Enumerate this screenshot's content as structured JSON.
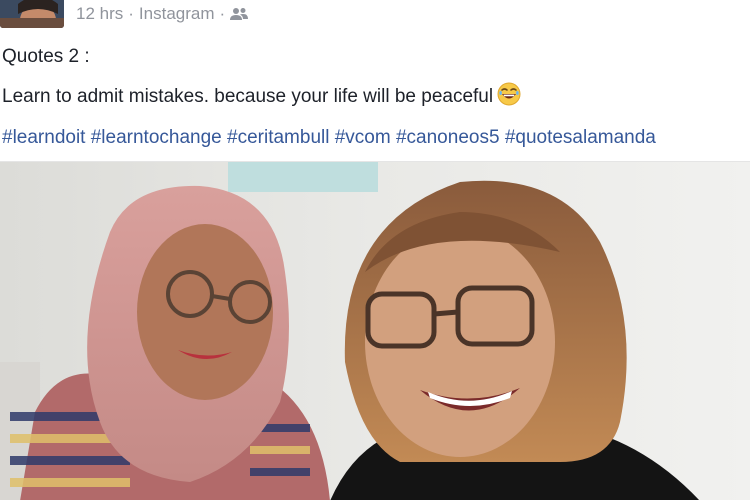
{
  "post": {
    "time": "12 hrs",
    "separator": "·",
    "source": "Instagram",
    "audience_icon": "friends-icon",
    "text_line1": "Quotes 2 :",
    "text_line2": "Learn to admit mistakes. because your life will be peaceful",
    "emoji_icon": "laughing-face-icon",
    "hashtags": [
      "#learndoit",
      "#learntochange",
      "#ceritambull",
      "#vcom",
      "#canoneos5",
      "#quotesalamanda"
    ]
  },
  "colors": {
    "meta_text": "#90949c",
    "body_text": "#1d2129",
    "link": "#365899"
  }
}
